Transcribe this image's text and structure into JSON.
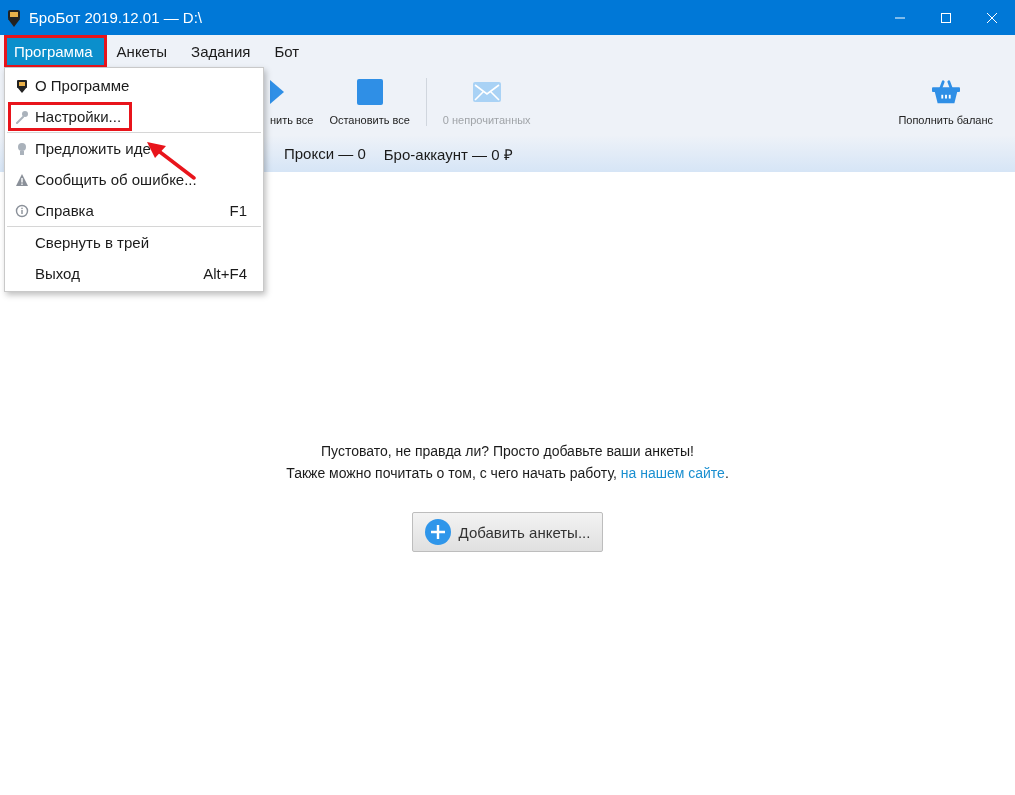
{
  "window": {
    "title": "БроБот 2019.12.01 — D:\\"
  },
  "menubar": [
    {
      "label": "Программа",
      "selected": true,
      "highlighted": true
    },
    {
      "label": "Анкеты",
      "selected": false,
      "highlighted": false
    },
    {
      "label": "Задания",
      "selected": false,
      "highlighted": false
    },
    {
      "label": "Бот",
      "selected": false,
      "highlighted": false
    }
  ],
  "dropdown": {
    "groups": [
      [
        {
          "label": "О Программе",
          "highlighted": false
        },
        {
          "label": "Настройки...",
          "highlighted": true
        }
      ],
      [
        {
          "label": "Предложить иде",
          "highlighted": false
        },
        {
          "label": "Сообщить об ошибке...",
          "highlighted": false
        },
        {
          "label": "Справка",
          "shortcut": "F1",
          "highlighted": false
        }
      ],
      [
        {
          "label": "Свернуть в трей",
          "highlighted": false
        },
        {
          "label": "Выход",
          "shortcut": "Alt+F4",
          "highlighted": false
        }
      ]
    ]
  },
  "toolbar": {
    "left": [
      {
        "kind": "play",
        "label": "нить все",
        "disabled": false
      },
      {
        "kind": "stop",
        "label": "Остановить все",
        "disabled": false
      },
      {
        "kind": "mail",
        "label": "0 непрочитанных",
        "disabled": true
      }
    ],
    "right": [
      {
        "kind": "basket",
        "label": "Пополнить баланс",
        "disabled": false
      }
    ]
  },
  "status": [
    "Прокси — 0",
    "Бро-аккаунт — 0 ₽"
  ],
  "empty_state": {
    "line_1": "Пустовато, не правда ли? Просто добавьте ваши анкеты!",
    "line_2": "Также можно почитать о том, с чего начать работу,",
    "link": "на нашем сайте",
    "line_2_end": ".",
    "button": "Добавить анкеты..."
  }
}
